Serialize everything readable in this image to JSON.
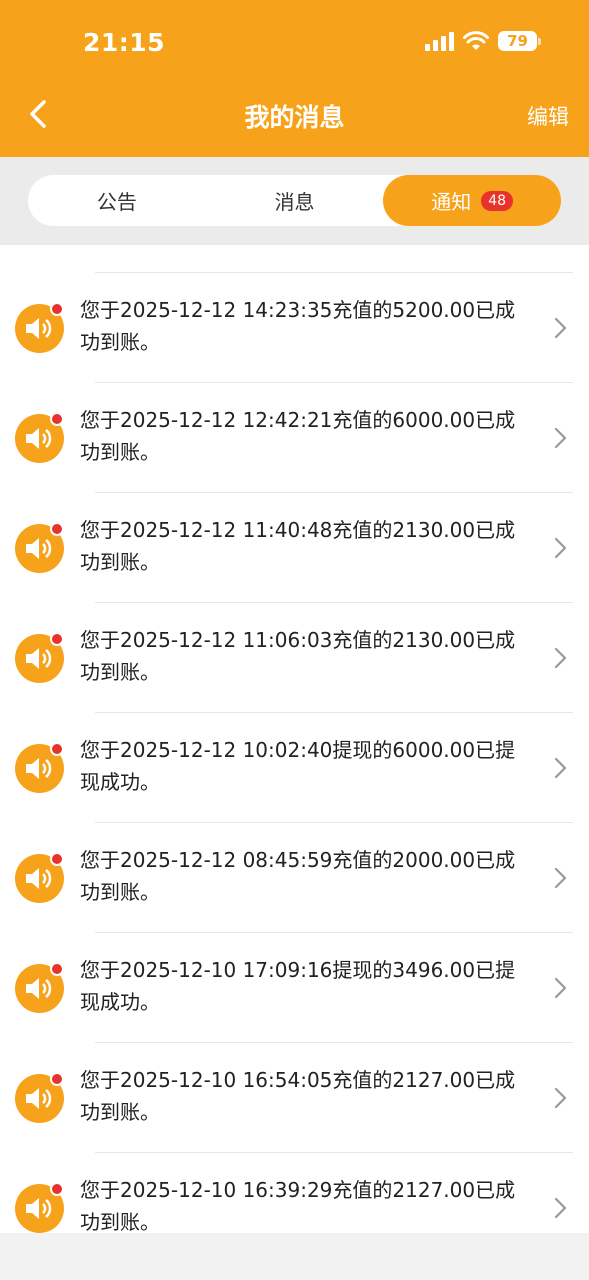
{
  "status_bar": {
    "time": "21:15",
    "battery": "79"
  },
  "header": {
    "title": "我的消息",
    "edit_label": "编辑"
  },
  "tabs": [
    {
      "label": "公告"
    },
    {
      "label": "消息"
    },
    {
      "label": "通知",
      "badge": "48"
    }
  ],
  "messages": [
    {
      "text": "您于2025-12-12 14:23:35充值的5200.00已成功到账。"
    },
    {
      "text": "您于2025-12-12 12:42:21充值的6000.00已成功到账。"
    },
    {
      "text": "您于2025-12-12 11:40:48充值的2130.00已成功到账。"
    },
    {
      "text": "您于2025-12-12 11:06:03充值的2130.00已成功到账。"
    },
    {
      "text": "您于2025-12-12 10:02:40提现的6000.00已提现成功。"
    },
    {
      "text": "您于2025-12-12 08:45:59充值的2000.00已成功到账。"
    },
    {
      "text": "您于2025-12-10 17:09:16提现的3496.00已提现成功。"
    },
    {
      "text": "您于2025-12-10 16:54:05充值的2127.00已成功到账。"
    },
    {
      "text": "您于2025-12-10 16:39:29充值的2127.00已成功到账。"
    }
  ],
  "colors": {
    "accent": "#f7a21b",
    "badge": "#e8322c"
  }
}
